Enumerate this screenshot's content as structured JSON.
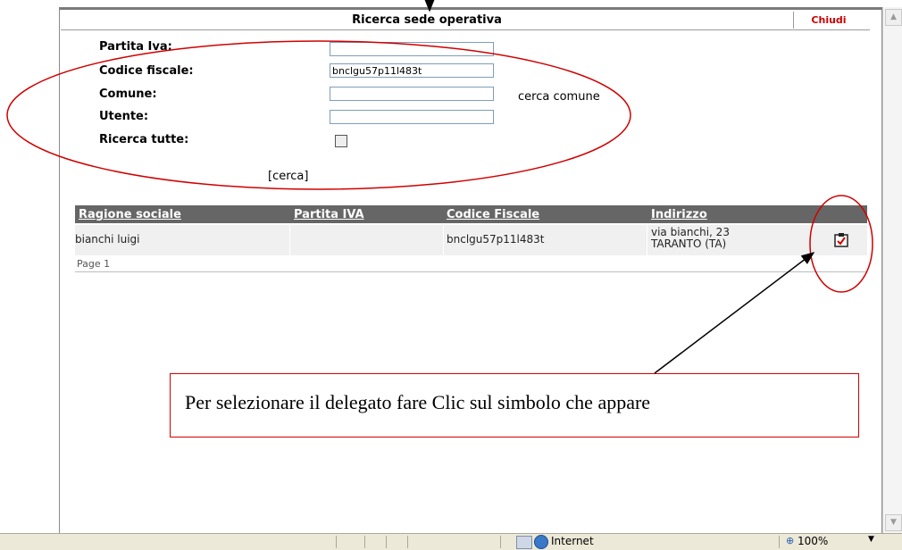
{
  "dialog": {
    "title": "Ricerca sede operativa",
    "close_label": "Chiudi"
  },
  "form": {
    "partita_iva_label": "Partita Iva:",
    "partita_iva_value": "",
    "codice_fiscale_label": "Codice fiscale:",
    "codice_fiscale_value": "bnclgu57p11l483t",
    "comune_label": "Comune:",
    "comune_value": "",
    "cerca_comune_link": "cerca comune",
    "utente_label": "Utente:",
    "utente_value": "",
    "ricerca_tutte_label": "Ricerca tutte:",
    "ricerca_tutte_checked": false,
    "cerca_link": "[cerca]"
  },
  "table": {
    "headers": [
      "Ragione sociale",
      "Partita IVA",
      "Codice Fiscale",
      "Indirizzo"
    ],
    "rows": [
      {
        "ragione_sociale": "bianchi luigi",
        "partita_iva": "",
        "codice_fiscale": "bnclgu57p11l483t",
        "indirizzo_line1": "via bianchi, 23",
        "indirizzo_line2": "TARANTO  (TA)",
        "action_icon": "select-clipboard-check-icon"
      }
    ],
    "pager": "Page 1"
  },
  "annotation": {
    "text": "Per selezionare il delegato fare Clic sul simbolo che appare",
    "color": "#d00000"
  },
  "statusbar": {
    "zone": "Internet",
    "zoom": "100%"
  },
  "colors": {
    "header_bg": "#666666",
    "row_bg": "#f0f0f0",
    "close_text": "#cc0000",
    "annotation_red": "#d00000"
  }
}
